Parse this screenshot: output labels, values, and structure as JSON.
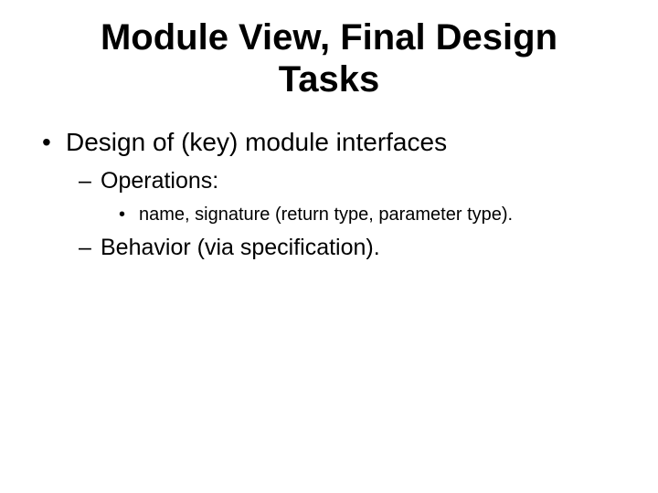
{
  "title": "Module View, Final Design Tasks",
  "bullets": {
    "l1_0": "Design of (key) module interfaces",
    "l2_0": "Operations:",
    "l3_0": "name, signature (return type, parameter type).",
    "l2_1": "Behavior (via specification)."
  }
}
